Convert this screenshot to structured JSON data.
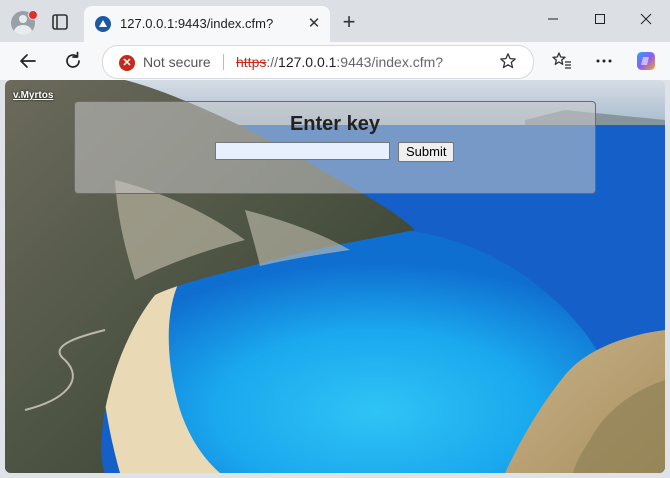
{
  "browser": {
    "tab": {
      "title": "127.0.0.1:9443/index.cfm?"
    },
    "omnibox": {
      "security_label": "Not secure",
      "url_scheme": "https",
      "url_sep": "://",
      "url_host": "127.0.0.1",
      "url_rest": ":9443/index.cfm?"
    }
  },
  "page": {
    "credit_link": "v.Myrtos",
    "form": {
      "heading": "Enter key",
      "key_value": "",
      "submit_label": "Submit"
    }
  },
  "icons": {
    "profile": "profile-avatar-icon",
    "tabs": "tab-actions-icon",
    "back": "back-arrow-icon",
    "reload": "reload-icon",
    "favorite": "star-icon",
    "favorites_list": "favorites-icon",
    "menu": "more-icon",
    "copilot": "copilot-icon"
  }
}
